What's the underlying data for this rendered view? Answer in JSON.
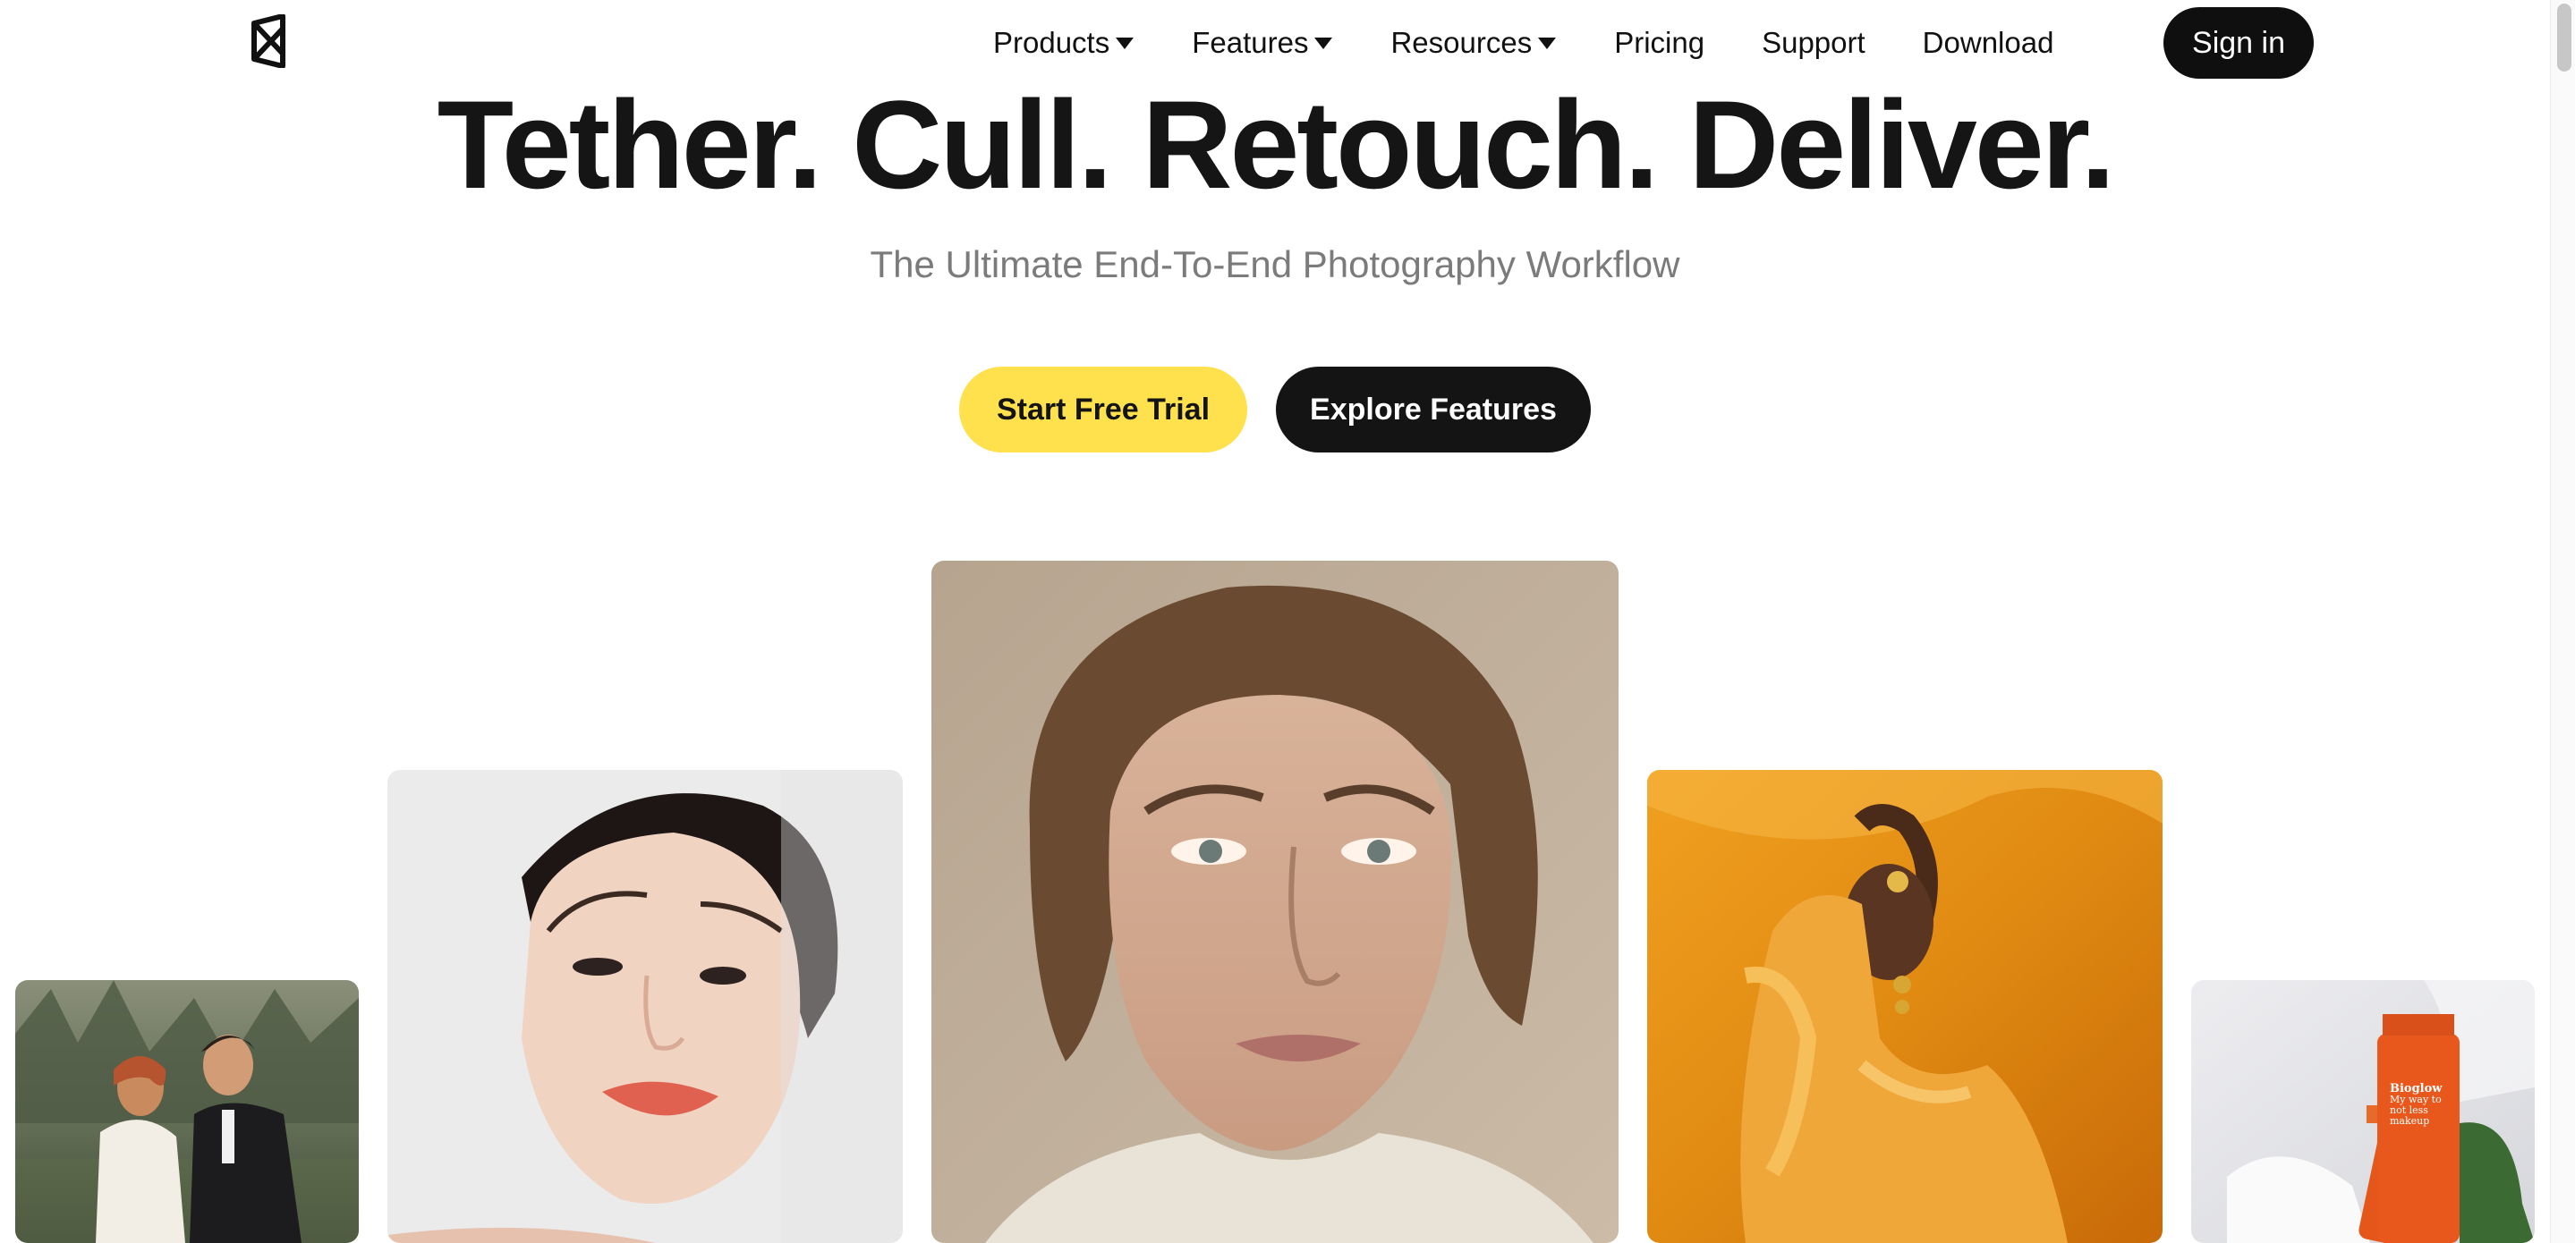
{
  "nav": {
    "logo_icon": "brand-logo-icon",
    "items": [
      {
        "label": "Products",
        "has_dropdown": true
      },
      {
        "label": "Features",
        "has_dropdown": true
      },
      {
        "label": "Resources",
        "has_dropdown": true
      },
      {
        "label": "Pricing",
        "has_dropdown": false
      },
      {
        "label": "Support",
        "has_dropdown": false
      },
      {
        "label": "Download",
        "has_dropdown": false
      }
    ],
    "signin_label": "Sign in"
  },
  "hero": {
    "title": "Tether. Cull. Retouch. Deliver.",
    "subtitle": "The Ultimate End-To-End Photography Workflow",
    "primary_cta": "Start Free Trial",
    "secondary_cta": "Explore Features"
  },
  "gallery": {
    "images": [
      {
        "name": "wedding-couple-photo"
      },
      {
        "name": "beauty-portrait-photo"
      },
      {
        "name": "woman-portrait-photo"
      },
      {
        "name": "orange-fashion-photo"
      },
      {
        "name": "skincare-product-photo"
      }
    ],
    "product_text": [
      "Bioglow",
      "My way to",
      "not less",
      "makeup"
    ]
  },
  "colors": {
    "accent_yellow": "#ffe14d",
    "dark": "#141414",
    "subtitle_gray": "#7b7b7b"
  }
}
